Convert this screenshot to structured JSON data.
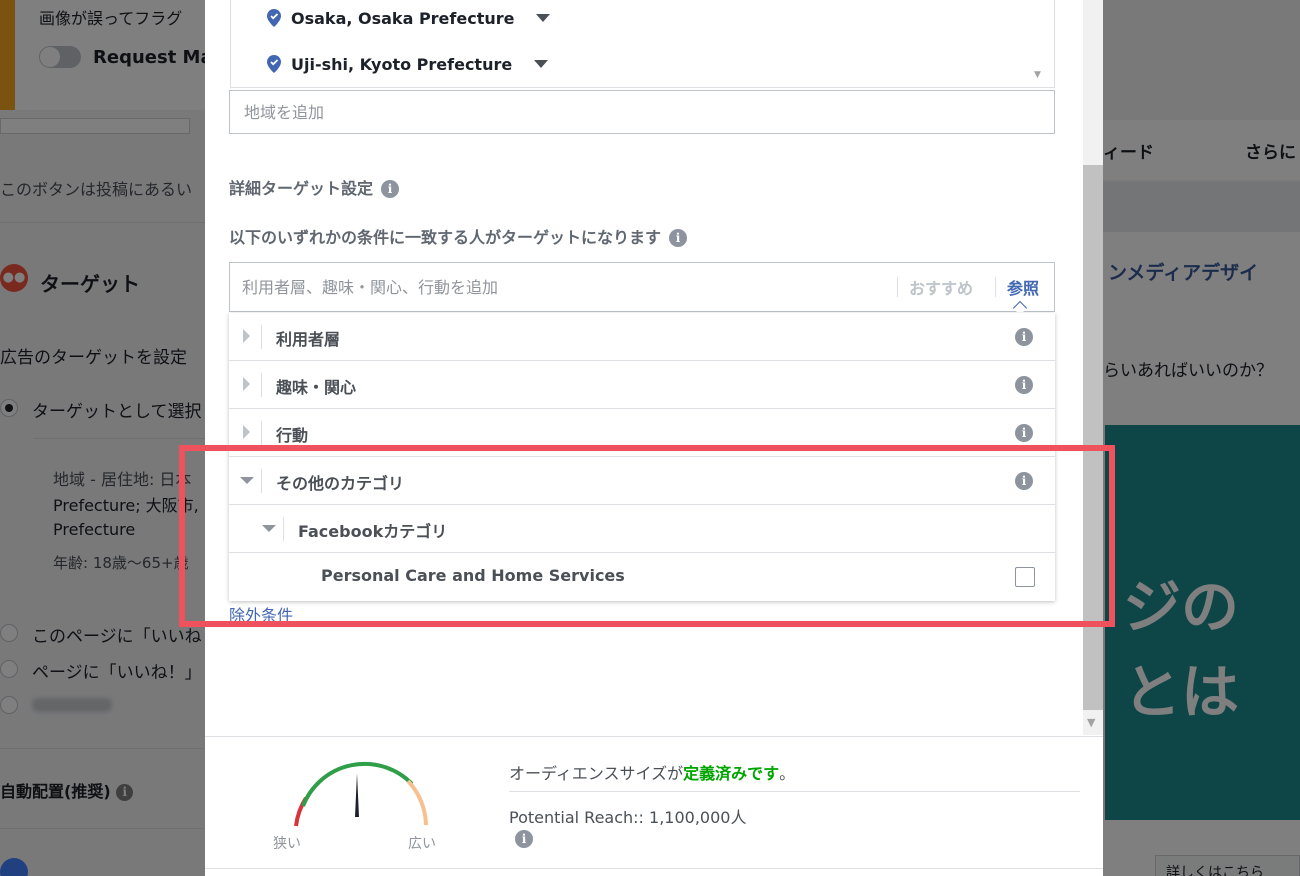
{
  "background": {
    "flag_notice": "画像が誤ってフラグ",
    "request_toggle_label": "Request Ma",
    "button_note": "このボタンは投稿にあるい",
    "target_title": "ターゲット",
    "target_desc": "広告のターゲットを設定",
    "target_select_option": "ターゲットとして選択",
    "location_line1": "地域 - 居住地: 日本",
    "location_line2": "Prefecture; 大阪市,",
    "location_line3": "Prefecture",
    "age_line": "年齢: 18歳〜65+歳",
    "option_like_page": "このページに「いいね",
    "option_page_like": "ページに「いいね！」",
    "auto_placement": "自動配置(推奨)",
    "tab_feed": "ィード",
    "tab_more": "さらに",
    "right_title": "ンメディアデザイ",
    "right_question": "らいあればいいのか？",
    "right_big1": "ジの",
    "right_big2": "とは",
    "right_button": "詳しくはこちら"
  },
  "modal": {
    "locations": [
      {
        "name": "Osaka, Osaka Prefecture"
      },
      {
        "name": "Uji-shi, Kyoto Prefecture"
      }
    ],
    "add_region_placeholder": "地域を追加",
    "detail_targeting_label": "詳細ターゲット設定",
    "match_condition_label": "以下のいずれかの条件に一致する人がターゲットになります",
    "detail_input_placeholder": "利用者層、趣味・関心、行動を追加",
    "suggest_label": "おすすめ",
    "browse_label": "参照",
    "categories": [
      {
        "label": "利用者層",
        "state": "collapsed"
      },
      {
        "label": "趣味・関心",
        "state": "collapsed"
      },
      {
        "label": "行動",
        "state": "collapsed"
      },
      {
        "label": "その他のカテゴリ",
        "state": "expanded"
      },
      {
        "label": "Facebookカテゴリ",
        "state": "expanded"
      },
      {
        "label": "Personal Care and Home Services",
        "checked": false
      }
    ],
    "exclude_link": "除外条件",
    "audience_prefix": "オーディエンスサイズが",
    "audience_status": "定義済みです",
    "audience_suffix": "。",
    "potential_reach": "Potential Reach:: 1,100,000人",
    "gauge_narrow": "狭い",
    "gauge_wide": "広い",
    "info_glyph": "i"
  },
  "colors": {
    "link_blue": "#4267b2",
    "status_green": "#00a400",
    "highlight_red": "#f0525d",
    "gauge_red": "#d8343a",
    "gauge_green": "#2e9e48",
    "gauge_peach": "#f6c08f"
  }
}
